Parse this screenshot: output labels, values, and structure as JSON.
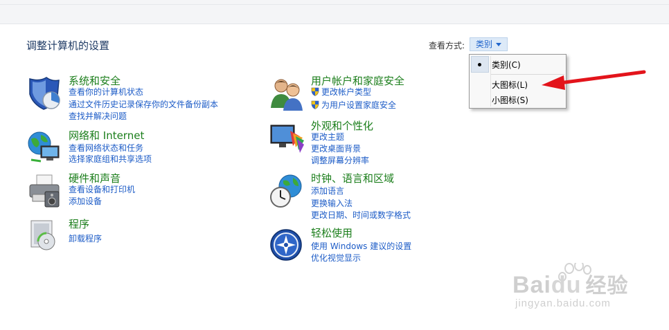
{
  "page": {
    "title": "调整计算机的设置",
    "view_by_label": "查看方式:",
    "view_by_value": "类别"
  },
  "view_menu": {
    "items": [
      "类别(C)",
      "大图标(L)",
      "小图标(S)"
    ],
    "selected_index": 0
  },
  "categories": {
    "system": {
      "title": "系统和安全",
      "links": [
        "查看你的计算机状态",
        "通过文件历史记录保存你的文件备份副本",
        "查找并解决问题"
      ]
    },
    "network": {
      "title": "网络和 Internet",
      "links": [
        "查看网络状态和任务",
        "选择家庭组和共享选项"
      ]
    },
    "hardware": {
      "title": "硬件和声音",
      "links": [
        "查看设备和打印机",
        "添加设备"
      ]
    },
    "programs": {
      "title": "程序",
      "links": [
        "卸载程序"
      ]
    },
    "user_accounts": {
      "title": "用户帐户和家庭安全",
      "links": [
        "更改帐户类型",
        "为用户设置家庭安全"
      ]
    },
    "appearance": {
      "title": "外观和个性化",
      "links": [
        "更改主题",
        "更改桌面背景",
        "调整屏幕分辨率"
      ]
    },
    "clock": {
      "title": "时钟、语言和区域",
      "links": [
        "添加语言",
        "更换输入法",
        "更改日期、时间或数字格式"
      ]
    },
    "ease": {
      "title": "轻松使用",
      "links": [
        "使用 Windows 建议的设置",
        "优化视觉显示"
      ]
    }
  },
  "watermark": {
    "brand_text": "Bai",
    "brand_text2": "du",
    "brand_text3": "经验",
    "url": "jingyan.baidu.com"
  },
  "colors": {
    "category_title": "#1b7e1b",
    "link": "#1d5cc7",
    "annotation_arrow": "#e3141b"
  },
  "icons": {
    "system": "shield-icon",
    "network": "globe-network-icon",
    "hardware": "printer-icon",
    "programs": "programs-box-icon",
    "user_accounts": "users-icon",
    "appearance": "monitor-palette-icon",
    "clock": "clock-globe-icon",
    "ease": "ease-of-access-icon"
  }
}
